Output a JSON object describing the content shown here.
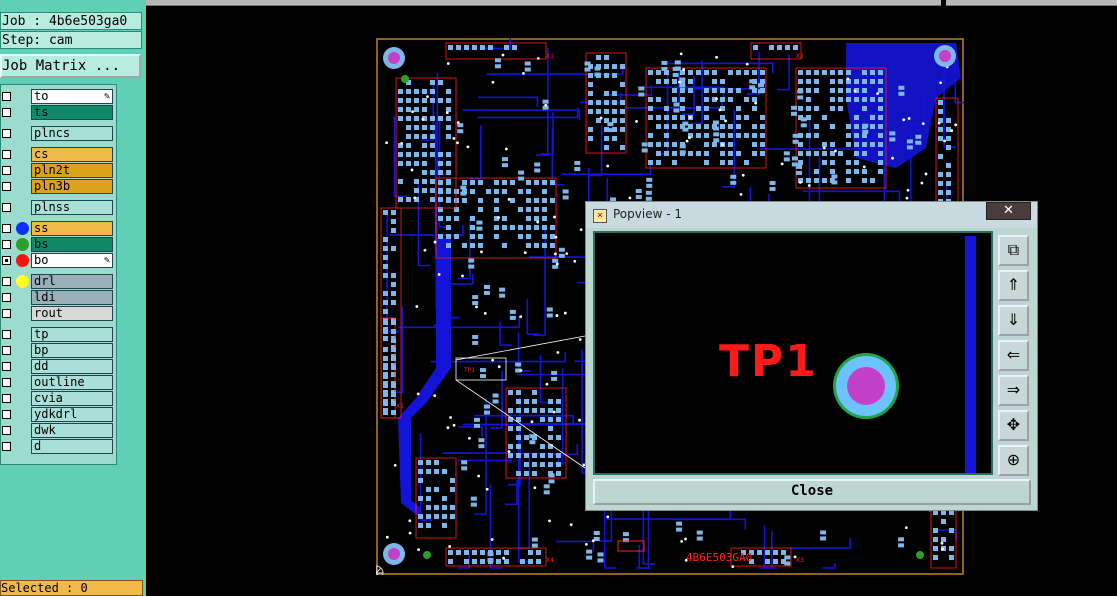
{
  "header": {
    "job": "Job : 4b6e503ga0",
    "step": "Step: cam",
    "matrix_button": "Job Matrix ..."
  },
  "layers": [
    {
      "name": "to",
      "color": "#ffffff",
      "dot": null,
      "checked": false,
      "selected": true,
      "icon": "edit-icon"
    },
    {
      "name": "ts",
      "color": "#0e8a68",
      "dot": null,
      "checked": false
    },
    {
      "name": "plncs",
      "color": "#a8e0d8",
      "dot": null,
      "checked": false
    },
    {
      "name": "cs",
      "color": "#f0b94a",
      "dot": null,
      "checked": false
    },
    {
      "name": "pln2t",
      "color": "#d9a31c",
      "dot": null,
      "checked": false
    },
    {
      "name": "pln3b",
      "color": "#d9a31c",
      "dot": null,
      "checked": false
    },
    {
      "name": "plnss",
      "color": "#a8e0d8",
      "dot": null,
      "checked": false
    },
    {
      "name": "ss",
      "color": "#f0b94a",
      "dot": "#1030ff",
      "checked": false
    },
    {
      "name": "bs",
      "color": "#0e8a68",
      "dot": "#2e9e2e",
      "checked": false
    },
    {
      "name": "bo",
      "color": "#ffffff",
      "dot": "#ff1010",
      "checked": true,
      "selected": true,
      "icon": "edit-icon"
    },
    {
      "name": "drl",
      "color": "#9ab0b8",
      "dot": "#ffff20",
      "checked": false
    },
    {
      "name": "ldi",
      "color": "#9ab0b8",
      "dot": null,
      "checked": false
    },
    {
      "name": "rout",
      "color": "#d8d8d8",
      "dot": null,
      "checked": false
    },
    {
      "name": "tp",
      "color": "#a8e0d8",
      "dot": null,
      "checked": false
    },
    {
      "name": "bp",
      "color": "#a8e0d8",
      "dot": null,
      "checked": false
    },
    {
      "name": "dd",
      "color": "#a8e0d8",
      "dot": null,
      "checked": false
    },
    {
      "name": "outline",
      "color": "#a8e0d8",
      "dot": null,
      "checked": false
    },
    {
      "name": "cvia",
      "color": "#a8e0d8",
      "dot": null,
      "checked": false
    },
    {
      "name": "ydkdrl",
      "color": "#a8e0d8",
      "dot": null,
      "checked": false
    },
    {
      "name": "dwk",
      "color": "#a8e0d8",
      "dot": null,
      "checked": false
    },
    {
      "name": "d",
      "color": "#a8e0d8",
      "dot": null,
      "checked": false
    }
  ],
  "status": {
    "selected": "Selected : 0"
  },
  "board": {
    "silk_text": "4B6E503GA0",
    "tp_label": "TP1",
    "connector_labels": [
      "X1",
      "X2",
      "X3",
      "X4",
      "X5"
    ]
  },
  "popup": {
    "title": "Popview - 1",
    "close_x": "✕",
    "close_button": "Close",
    "label": "TP1",
    "tools": [
      "zoom-window-icon",
      "pan-up-icon",
      "pan-down-icon",
      "pan-left-icon",
      "pan-right-icon",
      "fit-icon",
      "zoom-center-icon"
    ]
  },
  "colors": {
    "panel": "#5fcfb5",
    "trace": "#1414d8",
    "pad": "#7fb6e8",
    "silk": "#ff2020",
    "outline": "#c0802a"
  }
}
